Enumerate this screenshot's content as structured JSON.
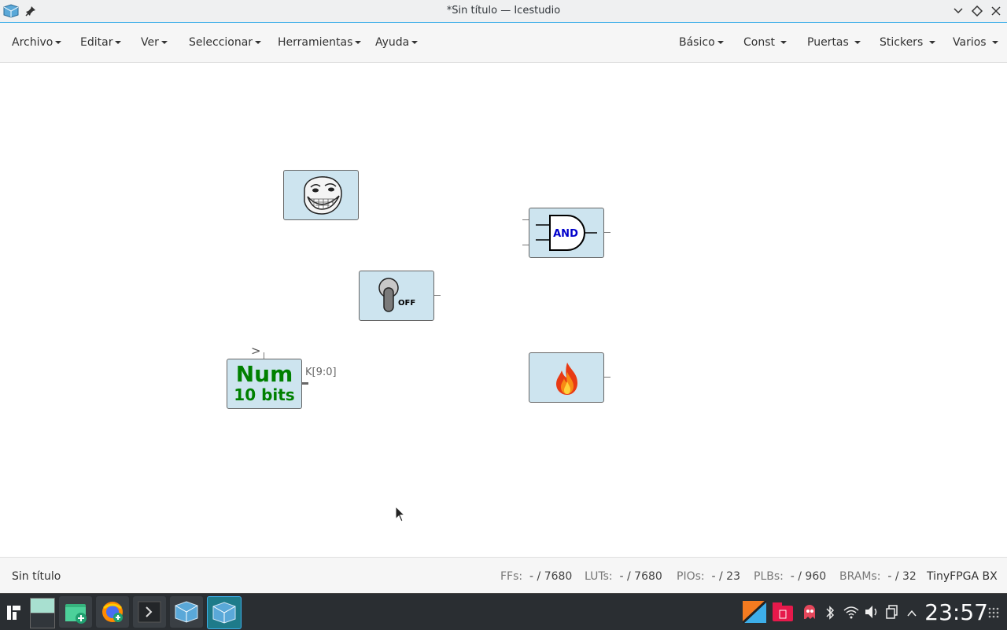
{
  "window": {
    "title": "*Sin título — Icestudio"
  },
  "menus_left": [
    {
      "label": "Archivo"
    },
    {
      "label": "Editar"
    },
    {
      "label": "Ver"
    },
    {
      "label": "Seleccionar"
    },
    {
      "label": "Herramientas"
    },
    {
      "label": "Ayuda"
    }
  ],
  "menus_right": [
    {
      "label": "Básico"
    },
    {
      "label": "Const"
    },
    {
      "label": "Puertas"
    },
    {
      "label": "Stickers"
    },
    {
      "label": "Varios"
    }
  ],
  "blocks": {
    "num": {
      "line1": "Num",
      "line2": "10 bits",
      "port_label": "K[9:0]",
      "clock_symbol": ">"
    },
    "and": {
      "label": "AND"
    },
    "switch": {
      "label": "OFF"
    }
  },
  "status": {
    "filename": "Sin título",
    "ffs_label": "FFs:",
    "ffs_value": "- / 7680",
    "luts_label": "LUTs:",
    "luts_value": "- / 7680",
    "pios_label": "PIOs:",
    "pios_value": "- / 23",
    "plbs_label": "PLBs:",
    "plbs_value": "- / 960",
    "brams_label": "BRAMs:",
    "brams_value": "- / 32",
    "board": "TinyFPGA BX"
  },
  "taskbar": {
    "clock": "23:57"
  },
  "colors": {
    "accent": "#3daee9",
    "block_bg": "#cde4ef",
    "num_green": "#008000",
    "and_blue": "#0000cc"
  }
}
